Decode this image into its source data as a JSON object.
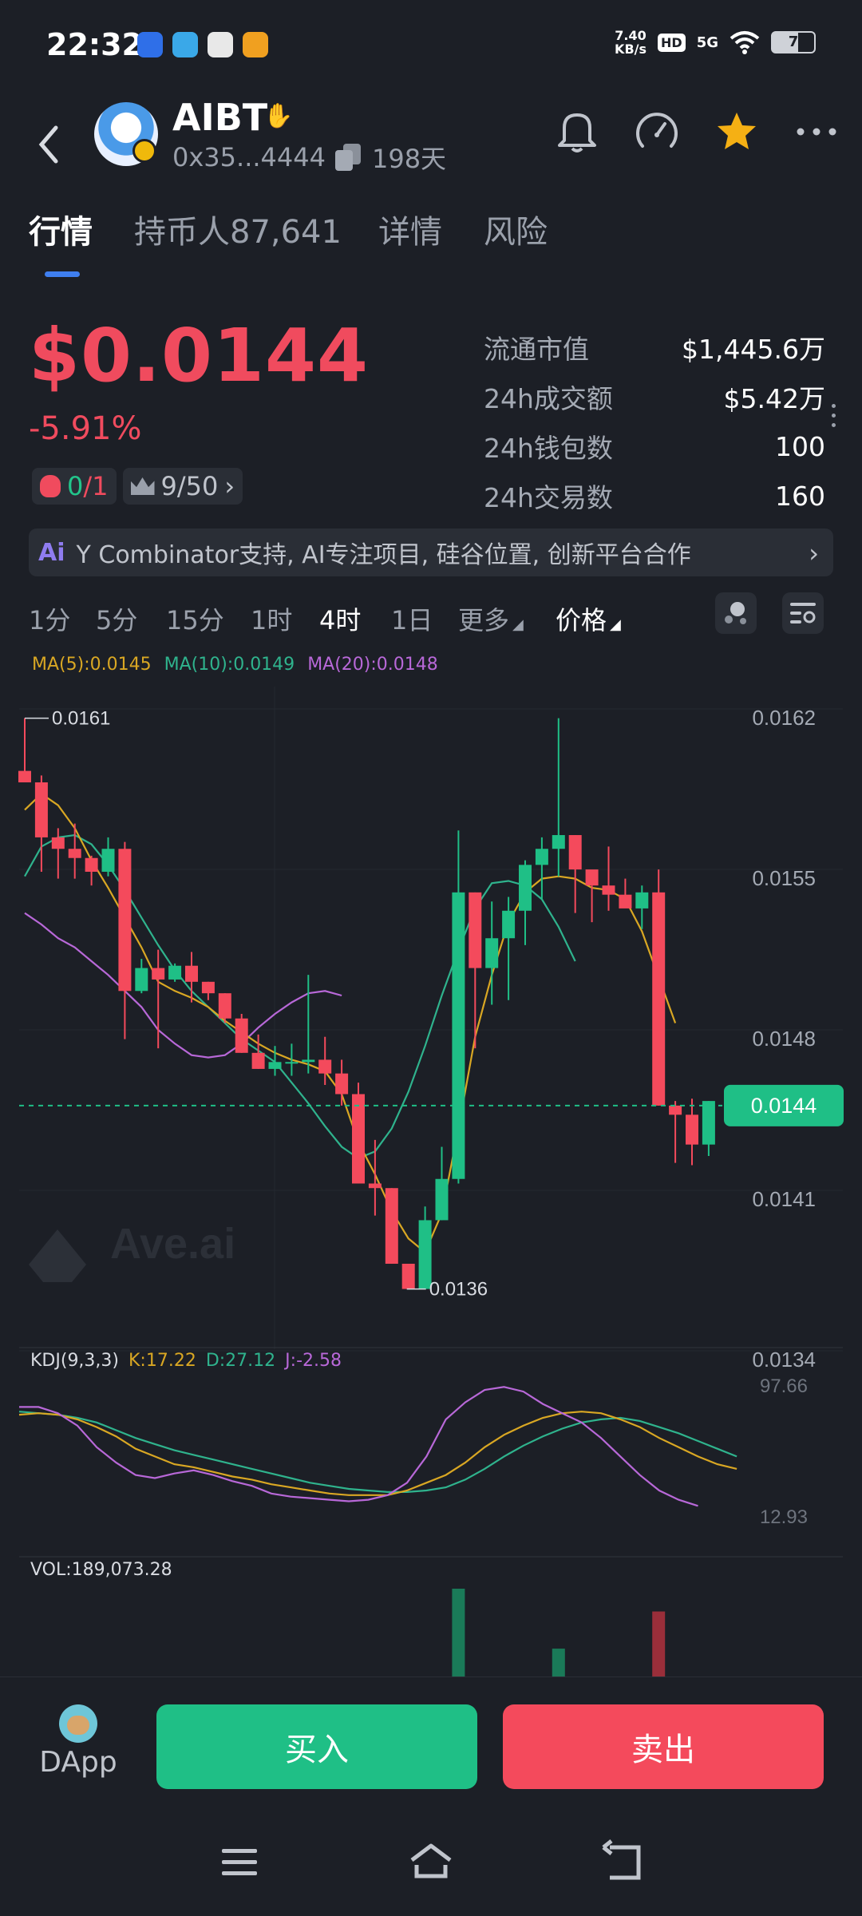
{
  "status_bar": {
    "time": "22:32",
    "net_speed_value": "7.40",
    "net_speed_unit": "KB/s",
    "hd": "HD",
    "network": "5G",
    "battery": "7"
  },
  "header": {
    "symbol": "AIBT",
    "address": "0x35...4444",
    "age": "198天",
    "icons": [
      "back-icon",
      "bell-icon",
      "gauge-icon",
      "star-icon",
      "more-icon"
    ]
  },
  "tabs": [
    "行情",
    "持币人87,641",
    "详情",
    "风险"
  ],
  "price": {
    "value": "$0.0144",
    "change": "-5.91%",
    "chip1_a": "0",
    "chip1_b": "/1",
    "chip2": "9/50"
  },
  "stats": [
    {
      "label": "流通市值",
      "value": "$1,445.6万"
    },
    {
      "label": "24h成交额",
      "value": "$5.42万"
    },
    {
      "label": "24h钱包数",
      "value": "100"
    },
    {
      "label": "24h交易数",
      "value": "160"
    }
  ],
  "banner": {
    "icon_text": "Ai",
    "text": "Y Combinator支持, AI专注项目, 硅谷位置, 创新平台合作"
  },
  "intervals": {
    "items": [
      "1分",
      "5分",
      "15分",
      "1时",
      "4时",
      "1日",
      "更多",
      "价格"
    ],
    "active": "4时"
  },
  "ma": {
    "ma5": "MA(5):0.0145",
    "ma10": "MA(10):0.0149",
    "ma20": "MA(20):0.0148"
  },
  "colors": {
    "up": "#1fbf86",
    "down": "#f44a5c",
    "ma5": "#d9a723",
    "ma10": "#2fb38d",
    "ma20": "#b868d8",
    "accent": "#3f7ff0"
  },
  "chart_data": {
    "type": "candlestick",
    "y_ticks": [
      "0.0162",
      "0.0155",
      "0.0148",
      "0.0141",
      "0.0134"
    ],
    "ylim": [
      0.0134,
      0.0162
    ],
    "current_price": "0.0144",
    "high_label": "0.0161",
    "low_label": "0.0136",
    "watermark": "Ave.ai",
    "candles": [
      [
        0.01586,
        0.01581,
        0.01609,
        0.01583
      ],
      [
        0.01581,
        0.01557,
        0.01584,
        0.01542
      ],
      [
        0.01557,
        0.01552,
        0.01561,
        0.01539
      ],
      [
        0.01552,
        0.01548,
        0.01563,
        0.01539
      ],
      [
        0.01548,
        0.01542,
        0.01549,
        0.01536
      ],
      [
        0.01542,
        0.01552,
        0.01557,
        0.0154
      ],
      [
        0.01552,
        0.0149,
        0.01555,
        0.01469
      ],
      [
        0.0149,
        0.015,
        0.01504,
        0.01489
      ],
      [
        0.015,
        0.01495,
        0.01508,
        0.01465
      ],
      [
        0.01495,
        0.01501,
        0.01502,
        0.01494
      ],
      [
        0.01501,
        0.01494,
        0.01507,
        0.01485
      ],
      [
        0.01494,
        0.01489,
        0.01494,
        0.01486
      ],
      [
        0.01489,
        0.01478,
        0.01489,
        0.01476
      ],
      [
        0.01478,
        0.01463,
        0.0148,
        0.01463
      ],
      [
        0.01463,
        0.01456,
        0.01471,
        0.01456
      ],
      [
        0.01456,
        0.01459,
        0.01466,
        0.01453
      ],
      [
        0.01459,
        0.01459,
        0.01467,
        0.01453
      ],
      [
        0.01459,
        0.0146,
        0.01497,
        0.01454
      ],
      [
        0.0146,
        0.01454,
        0.0147,
        0.01449
      ],
      [
        0.01454,
        0.01445,
        0.0146,
        0.0144
      ],
      [
        0.01445,
        0.01406,
        0.0145,
        0.01406
      ],
      [
        0.01406,
        0.01404,
        0.01425,
        0.01392
      ],
      [
        0.01404,
        0.01371,
        0.01404,
        0.01371
      ],
      [
        0.01371,
        0.0136,
        0.01371,
        0.0136
      ],
      [
        0.0136,
        0.0139,
        0.01396,
        0.01362
      ],
      [
        0.0139,
        0.01408,
        0.01422,
        0.0139
      ],
      [
        0.01408,
        0.01533,
        0.0156,
        0.01406
      ],
      [
        0.01533,
        0.015,
        0.01533,
        0.01465
      ],
      [
        0.015,
        0.01513,
        0.01529,
        0.01484
      ],
      [
        0.01513,
        0.01525,
        0.01531,
        0.01486
      ],
      [
        0.01525,
        0.01545,
        0.01547,
        0.0151
      ],
      [
        0.01545,
        0.01552,
        0.01557,
        0.0153
      ],
      [
        0.01552,
        0.01558,
        0.01609,
        0.0154
      ],
      [
        0.01558,
        0.01543,
        0.01558,
        0.01524
      ],
      [
        0.01543,
        0.01536,
        0.01536,
        0.0152
      ],
      [
        0.01536,
        0.01532,
        0.01553,
        0.01525
      ],
      [
        0.01532,
        0.01526,
        0.01539,
        0.01528
      ],
      [
        0.01526,
        0.01533,
        0.01536,
        0.01517
      ],
      [
        0.01533,
        0.0144,
        0.01543,
        0.0144
      ],
      [
        0.0144,
        0.01436,
        0.01442,
        0.01415
      ],
      [
        0.01436,
        0.01423,
        0.01443,
        0.01414
      ],
      [
        0.01423,
        0.01442,
        0.01442,
        0.01418
      ]
    ],
    "ma5_line": [
      0.01569,
      0.01576,
      0.01571,
      0.01561,
      0.01547,
      0.01535,
      0.01522,
      0.01509,
      0.01494,
      0.0149,
      0.01487,
      0.01483,
      0.01477,
      0.01472,
      0.01467,
      0.01463,
      0.0146,
      0.01458,
      0.01455,
      0.01445,
      0.01424,
      0.0141,
      0.01394,
      0.01382,
      0.01376,
      0.01393,
      0.0143,
      0.0147,
      0.01497,
      0.0152,
      0.01533,
      0.01539,
      0.0154,
      0.01539,
      0.01535,
      0.01534,
      0.0153,
      0.01516,
      0.01496,
      0.01476
    ],
    "ma10_line": [
      0.0154,
      0.01553,
      0.01557,
      0.01558,
      0.01554,
      0.01545,
      0.01534,
      0.01522,
      0.0151,
      0.01499,
      0.0149,
      0.01483,
      0.01476,
      0.01469,
      0.01464,
      0.01459,
      0.0145,
      0.01441,
      0.01431,
      0.01422,
      0.01417,
      0.0142,
      0.0143,
      0.01446,
      0.01466,
      0.01488,
      0.01508,
      0.01526,
      0.01537,
      0.01538,
      0.01536,
      0.0153,
      0.01518,
      0.01503
    ],
    "ma20_line": [
      0.01524,
      0.01519,
      0.01513,
      0.01509,
      0.01503,
      0.01497,
      0.0149,
      0.01483,
      0.01473,
      0.01467,
      0.01462,
      0.01461,
      0.01462,
      0.01467,
      0.01474,
      0.0148,
      0.01485,
      0.01489,
      0.0149,
      0.01488
    ],
    "kdj": {
      "label": "KDJ(9,3,3)",
      "k": "K:17.22",
      "d": "D:27.12",
      "j": "J:-2.58",
      "ylim": [
        12.93,
        97.66
      ],
      "y_ticks": [
        "97.66",
        "12.93"
      ],
      "k_line": [
        79,
        80,
        79,
        76,
        71,
        65,
        57,
        52,
        47,
        45,
        42,
        39,
        37,
        34,
        32,
        30,
        28,
        27,
        27,
        27,
        30,
        35,
        40,
        48,
        58,
        66,
        72,
        77,
        80,
        81,
        80,
        76,
        71,
        64,
        58,
        52,
        47,
        44
      ],
      "d_line": [
        81,
        80,
        79,
        77,
        74,
        69,
        64,
        60,
        56,
        53,
        50,
        47,
        44,
        41,
        38,
        35,
        33,
        31,
        30,
        29,
        29,
        30,
        32,
        37,
        44,
        52,
        59,
        65,
        70,
        74,
        76,
        77,
        75,
        71,
        67,
        62,
        57,
        52
      ],
      "j_line": [
        84,
        84,
        80,
        72,
        58,
        48,
        40,
        38,
        41,
        43,
        40,
        36,
        33,
        28,
        26,
        25,
        24,
        23,
        24,
        27,
        35,
        52,
        76,
        87,
        95,
        97,
        94,
        86,
        80,
        74,
        64,
        52,
        40,
        30,
        24,
        20
      ]
    },
    "volume": {
      "label": "VOL:189,073.28",
      "bars": [
        {
          "index": 26,
          "value": 189073,
          "dir": "up"
        },
        {
          "index": 32,
          "value": 60000,
          "dir": "up"
        },
        {
          "index": 38,
          "value": 140000,
          "dir": "down"
        }
      ]
    }
  },
  "bottom": {
    "dapp": "DApp",
    "buy": "买入",
    "sell": "卖出"
  }
}
